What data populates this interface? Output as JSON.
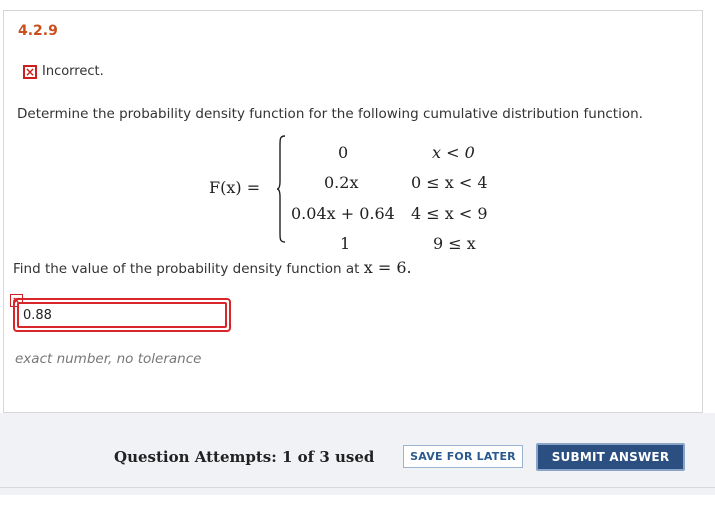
{
  "question": {
    "number": "4.2.9",
    "status_text": "Incorrect.",
    "prompt": "Determine the probability density function for the following cumulative distribution function.",
    "function_label": "F(x) =",
    "cdf_pieces": [
      {
        "expr": "0",
        "cond": "x < 0"
      },
      {
        "expr": "0.2x",
        "cond": "0 ≤ x < 4"
      },
      {
        "expr": "0.04x + 0.64",
        "cond": "4 ≤ x < 9"
      },
      {
        "expr": "1",
        "cond": "9 ≤ x"
      }
    ],
    "find_text": "Find the value of the probability density function at",
    "find_math": "x = 6.",
    "answer_value": "0.88",
    "answer_hint": "exact number, no tolerance"
  },
  "footer": {
    "attempts_text": "Question Attempts: 1 of 3 used",
    "save_label": "SAVE FOR LATER",
    "submit_label": "SUBMIT ANSWER"
  },
  "colors": {
    "accent_orange": "#c8501e",
    "error_red": "#d9262a",
    "submit_blue": "#2a4f80"
  }
}
